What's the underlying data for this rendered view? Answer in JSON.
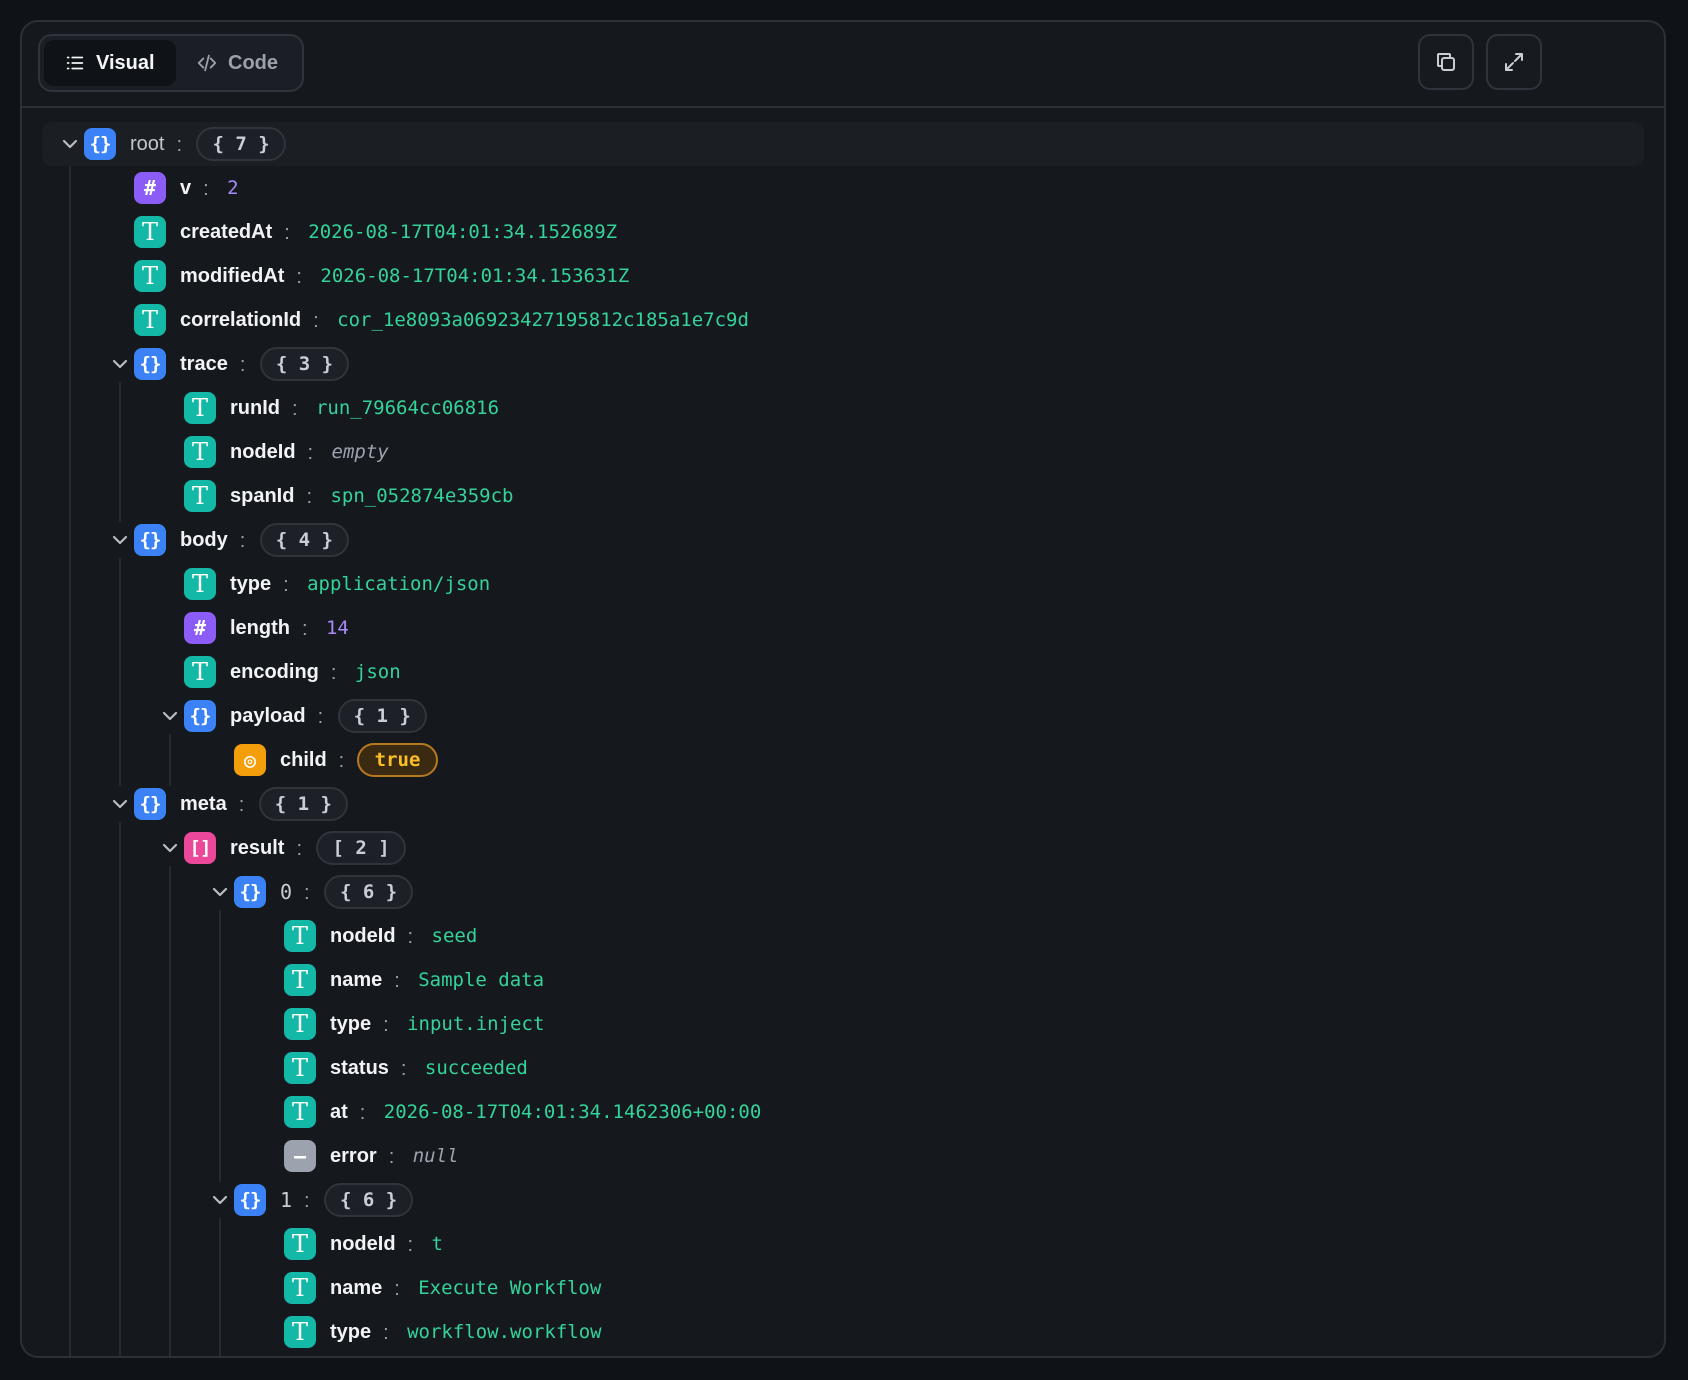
{
  "toolbar": {
    "tabs": [
      {
        "label": "Visual",
        "icon": "list-icon",
        "active": true
      },
      {
        "label": "Code",
        "icon": "code-icon",
        "active": false
      }
    ],
    "actions": [
      {
        "name": "copy-icon"
      },
      {
        "name": "expand-icon"
      }
    ]
  },
  "colors": {
    "object": "#3b82f6",
    "array": "#ec4899",
    "string": "#14b8a6",
    "number": "#8b5cf6",
    "boolean": "#f59e0b",
    "null": "#9ca3af"
  },
  "tree": [
    {
      "depth": 0,
      "type": "object",
      "key": "root",
      "count": "{ 7 }",
      "expanded": true
    },
    {
      "depth": 1,
      "type": "number",
      "key": "v",
      "value": "2"
    },
    {
      "depth": 1,
      "type": "string",
      "key": "createdAt",
      "value": "2026-08-17T04:01:34.152689Z"
    },
    {
      "depth": 1,
      "type": "string",
      "key": "modifiedAt",
      "value": "2026-08-17T04:01:34.153631Z"
    },
    {
      "depth": 1,
      "type": "string",
      "key": "correlationId",
      "value": "cor_1e8093a06923427195812c185a1e7c9d"
    },
    {
      "depth": 1,
      "type": "object",
      "key": "trace",
      "count": "{ 3 }",
      "expanded": true
    },
    {
      "depth": 2,
      "type": "string",
      "key": "runId",
      "value": "run_79664cc06816"
    },
    {
      "depth": 2,
      "type": "string",
      "key": "nodeId",
      "value": "empty",
      "empty": true
    },
    {
      "depth": 2,
      "type": "string",
      "key": "spanId",
      "value": "spn_052874e359cb"
    },
    {
      "depth": 1,
      "type": "object",
      "key": "body",
      "count": "{ 4 }",
      "expanded": true
    },
    {
      "depth": 2,
      "type": "string",
      "key": "type",
      "value": "application/json"
    },
    {
      "depth": 2,
      "type": "number",
      "key": "length",
      "value": "14"
    },
    {
      "depth": 2,
      "type": "string",
      "key": "encoding",
      "value": "json"
    },
    {
      "depth": 2,
      "type": "object",
      "key": "payload",
      "count": "{ 1 }",
      "expanded": true
    },
    {
      "depth": 3,
      "type": "boolean",
      "key": "child",
      "value": "true"
    },
    {
      "depth": 1,
      "type": "object",
      "key": "meta",
      "count": "{ 1 }",
      "expanded": true
    },
    {
      "depth": 2,
      "type": "array",
      "key": "result",
      "count": "[ 2 ]",
      "expanded": true
    },
    {
      "depth": 3,
      "type": "object",
      "key": "0",
      "count": "{ 6 }",
      "expanded": true,
      "index": true
    },
    {
      "depth": 4,
      "type": "string",
      "key": "nodeId",
      "value": "seed"
    },
    {
      "depth": 4,
      "type": "string",
      "key": "name",
      "value": "Sample data"
    },
    {
      "depth": 4,
      "type": "string",
      "key": "type",
      "value": "input.inject"
    },
    {
      "depth": 4,
      "type": "string",
      "key": "status",
      "value": "succeeded"
    },
    {
      "depth": 4,
      "type": "string",
      "key": "at",
      "value": "2026-08-17T04:01:34.1462306+00:00"
    },
    {
      "depth": 4,
      "type": "null",
      "key": "error",
      "value": "null"
    },
    {
      "depth": 3,
      "type": "object",
      "key": "1",
      "count": "{ 6 }",
      "expanded": true,
      "index": true
    },
    {
      "depth": 4,
      "type": "string",
      "key": "nodeId",
      "value": "t"
    },
    {
      "depth": 4,
      "type": "string",
      "key": "name",
      "value": "Execute Workflow"
    },
    {
      "depth": 4,
      "type": "string",
      "key": "type",
      "value": "workflow.workflow"
    }
  ]
}
